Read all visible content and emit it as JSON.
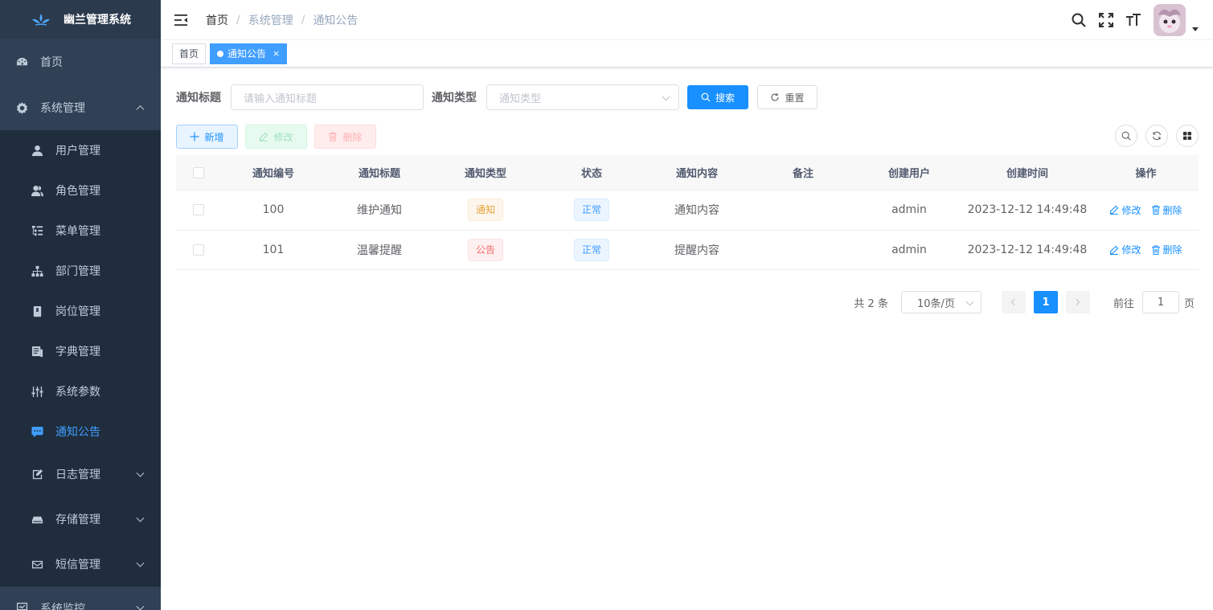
{
  "app": {
    "title": "幽兰管理系统"
  },
  "sidebar": {
    "home": "首页",
    "system": "系统管理",
    "sub_items": [
      {
        "label": "用户管理",
        "icon": "user-icon"
      },
      {
        "label": "角色管理",
        "icon": "peoples-icon"
      },
      {
        "label": "菜单管理",
        "icon": "tree-table-icon"
      },
      {
        "label": "部门管理",
        "icon": "tree-icon"
      },
      {
        "label": "岗位管理",
        "icon": "post-icon"
      },
      {
        "label": "字典管理",
        "icon": "dict-icon"
      },
      {
        "label": "系统参数",
        "icon": "edit-params-icon"
      },
      {
        "label": "通知公告",
        "icon": "message-icon"
      },
      {
        "label": "日志管理",
        "icon": "log-icon"
      },
      {
        "label": "存储管理",
        "icon": "storage-icon"
      },
      {
        "label": "短信管理",
        "icon": "email-icon"
      }
    ],
    "monitor": "系统监控"
  },
  "breadcrumb": [
    "首页",
    "系统管理",
    "通知公告"
  ],
  "tags": {
    "home": "首页",
    "active": "通知公告",
    "close": "×"
  },
  "search": {
    "title_label": "通知标题",
    "title_placeholder": "请输入通知标题",
    "type_label": "通知类型",
    "type_placeholder": "通知类型",
    "search_btn": "搜索",
    "reset_btn": "重置"
  },
  "toolbar": {
    "add": "新增",
    "edit": "修改",
    "delete": "删除"
  },
  "table": {
    "headers": [
      "通知编号",
      "通知标题",
      "通知类型",
      "状态",
      "通知内容",
      "备注",
      "创建用户",
      "创建时间",
      "操作"
    ],
    "rows": [
      {
        "id": "100",
        "title": "维护通知",
        "type": "通知",
        "status": "正常",
        "content": "通知内容",
        "remark": "",
        "user": "admin",
        "time": "2023-12-12 14:49:48"
      },
      {
        "id": "101",
        "title": "温馨提醒",
        "type": "公告",
        "status": "正常",
        "content": "提醒内容",
        "remark": "",
        "user": "admin",
        "time": "2023-12-12 14:49:48"
      }
    ],
    "op_edit": "修改",
    "op_delete": "删除"
  },
  "pagination": {
    "total": "共 2 条",
    "page_size": "10条/页",
    "current": "1",
    "goto_label": "前往",
    "goto_value": "1",
    "page_suffix": "页"
  },
  "colors": {
    "primary": "#1890ff",
    "sidebar_bg": "#304156",
    "active_menu": "#409eff"
  }
}
